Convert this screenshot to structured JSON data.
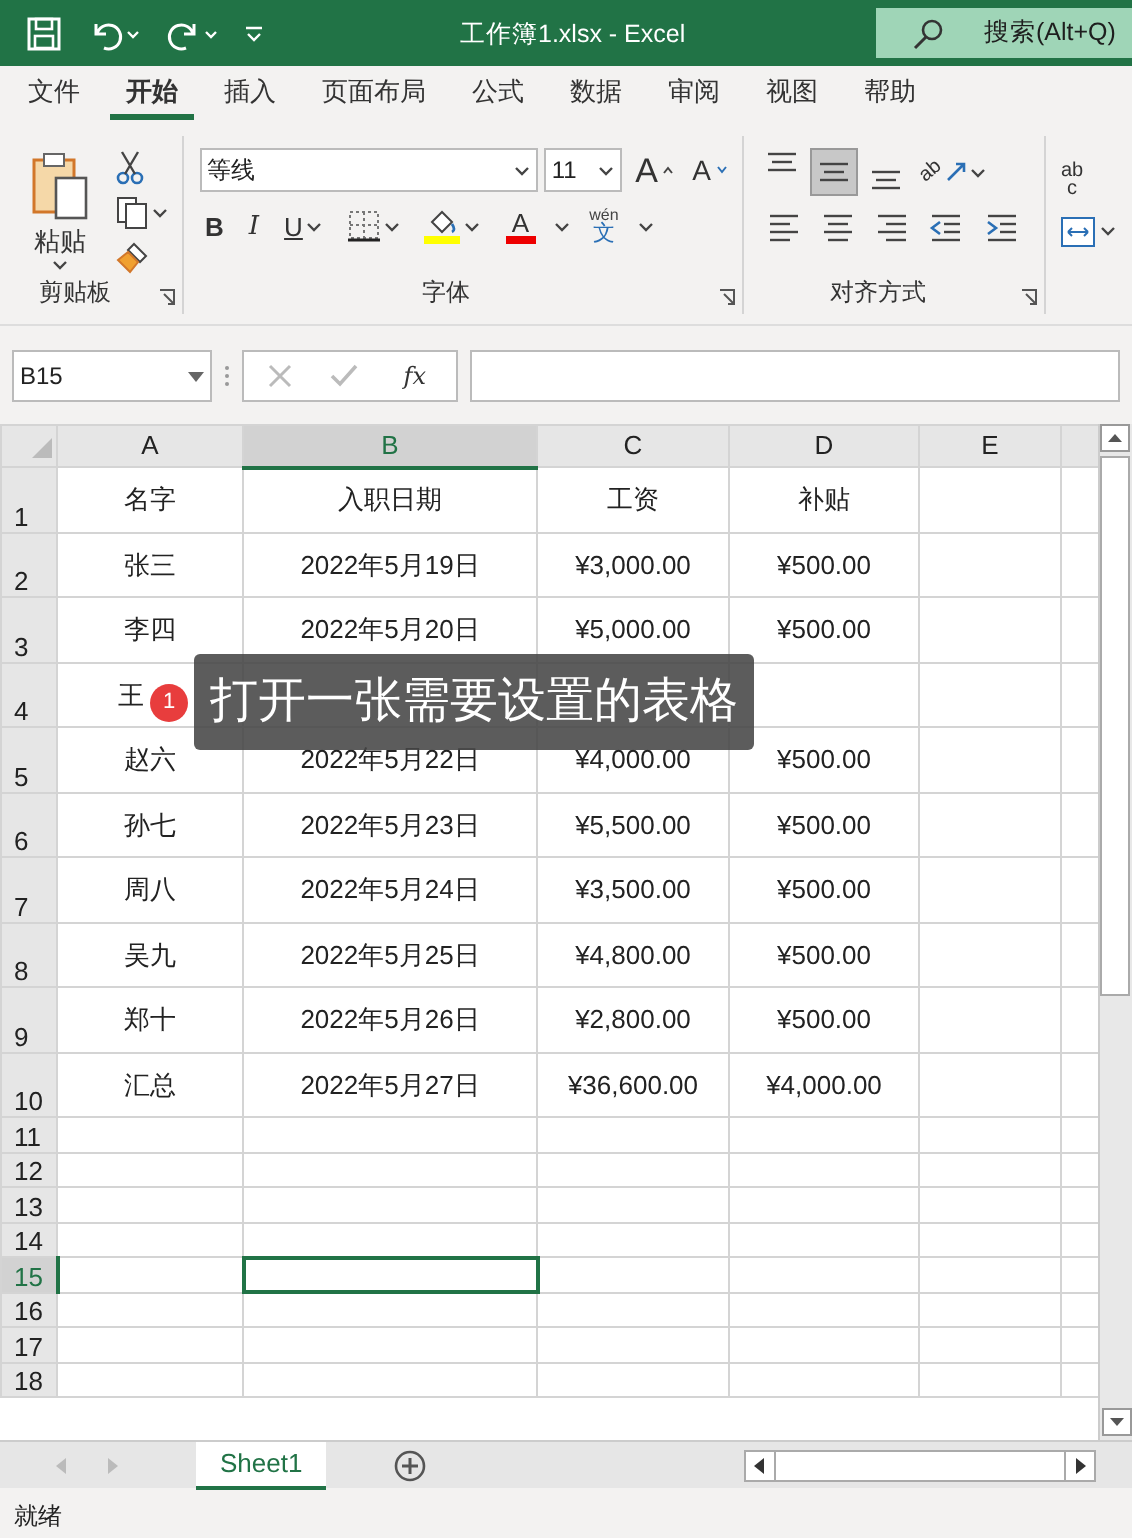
{
  "title_bar": {
    "title": "工作簿1.xlsx  -  Excel",
    "search_placeholder": "搜索(Alt+Q)"
  },
  "menu_tabs": [
    {
      "label": "文件",
      "selected": false
    },
    {
      "label": "开始",
      "selected": true
    },
    {
      "label": "插入",
      "selected": false
    },
    {
      "label": "页面布局",
      "selected": false
    },
    {
      "label": "公式",
      "selected": false
    },
    {
      "label": "数据",
      "selected": false
    },
    {
      "label": "审阅",
      "selected": false
    },
    {
      "label": "视图",
      "selected": false
    },
    {
      "label": "帮助",
      "selected": false
    }
  ],
  "ribbon": {
    "clipboard": {
      "paste_label": "粘贴",
      "group_label": "剪贴板"
    },
    "font": {
      "font_name": "等线",
      "font_size": "11",
      "grow_label": "A",
      "shrink_label": "A",
      "bold_label": "B",
      "italic_label": "I",
      "underline_label": "U",
      "font_color_label": "A",
      "phonetic_top": "wén",
      "phonetic_bottom": "文",
      "group_label": "字体"
    },
    "alignment": {
      "middle_align_selected": true,
      "orientation_label": "ab",
      "wrap_label_top": "ab",
      "wrap_label_bottom": "c",
      "group_label": "对齐方式"
    }
  },
  "formula_bar": {
    "name_box": "B15",
    "fx_label": "fx"
  },
  "columns": [
    {
      "label": "A",
      "selected": false
    },
    {
      "label": "B",
      "selected": true
    },
    {
      "label": "C",
      "selected": false
    },
    {
      "label": "D",
      "selected": false
    },
    {
      "label": "E",
      "selected": false
    }
  ],
  "rows": [
    {
      "number": "1",
      "selected": false,
      "cells": [
        "名字",
        "入职日期",
        "工资",
        "补贴",
        ""
      ]
    },
    {
      "number": "2",
      "selected": false,
      "cells": [
        "张三",
        "2022年5月19日",
        "¥3,000.00",
        "¥500.00",
        ""
      ]
    },
    {
      "number": "3",
      "selected": false,
      "cells": [
        "李四",
        "2022年5月20日",
        "¥5,000.00",
        "¥500.00",
        ""
      ]
    },
    {
      "number": "4",
      "selected": false,
      "cells": [
        "王",
        "",
        "",
        "",
        ""
      ]
    },
    {
      "number": "5",
      "selected": false,
      "cells": [
        "赵六",
        "2022年5月22日",
        "¥4,000.00",
        "¥500.00",
        ""
      ]
    },
    {
      "number": "6",
      "selected": false,
      "cells": [
        "孙七",
        "2022年5月23日",
        "¥5,500.00",
        "¥500.00",
        ""
      ]
    },
    {
      "number": "7",
      "selected": false,
      "cells": [
        "周八",
        "2022年5月24日",
        "¥3,500.00",
        "¥500.00",
        ""
      ]
    },
    {
      "number": "8",
      "selected": false,
      "cells": [
        "吴九",
        "2022年5月25日",
        "¥4,800.00",
        "¥500.00",
        ""
      ]
    },
    {
      "number": "9",
      "selected": false,
      "cells": [
        "郑十",
        "2022年5月26日",
        "¥2,800.00",
        "¥500.00",
        ""
      ]
    },
    {
      "number": "10",
      "selected": false,
      "cells": [
        "汇总",
        "2022年5月27日",
        "¥36,600.00",
        "¥4,000.00",
        ""
      ]
    },
    {
      "number": "11",
      "selected": false,
      "cells": [
        "",
        "",
        "",
        "",
        ""
      ]
    },
    {
      "number": "12",
      "selected": false,
      "cells": [
        "",
        "",
        "",
        "",
        ""
      ]
    },
    {
      "number": "13",
      "selected": false,
      "cells": [
        "",
        "",
        "",
        "",
        ""
      ]
    },
    {
      "number": "14",
      "selected": false,
      "cells": [
        "",
        "",
        "",
        "",
        ""
      ]
    },
    {
      "number": "15",
      "selected": true,
      "cells": [
        "",
        "",
        "",
        "",
        ""
      ]
    },
    {
      "number": "16",
      "selected": false,
      "cells": [
        "",
        "",
        "",
        "",
        ""
      ]
    },
    {
      "number": "17",
      "selected": false,
      "cells": [
        "",
        "",
        "",
        "",
        ""
      ]
    },
    {
      "number": "18",
      "selected": false,
      "cells": [
        "",
        "",
        "",
        "",
        ""
      ]
    }
  ],
  "callout": {
    "badge": "1",
    "text": "打开一张需要设置的表格"
  },
  "sheet_tabs": [
    {
      "label": "Sheet1",
      "selected": true
    }
  ],
  "status_bar": {
    "text": "就绪"
  }
}
